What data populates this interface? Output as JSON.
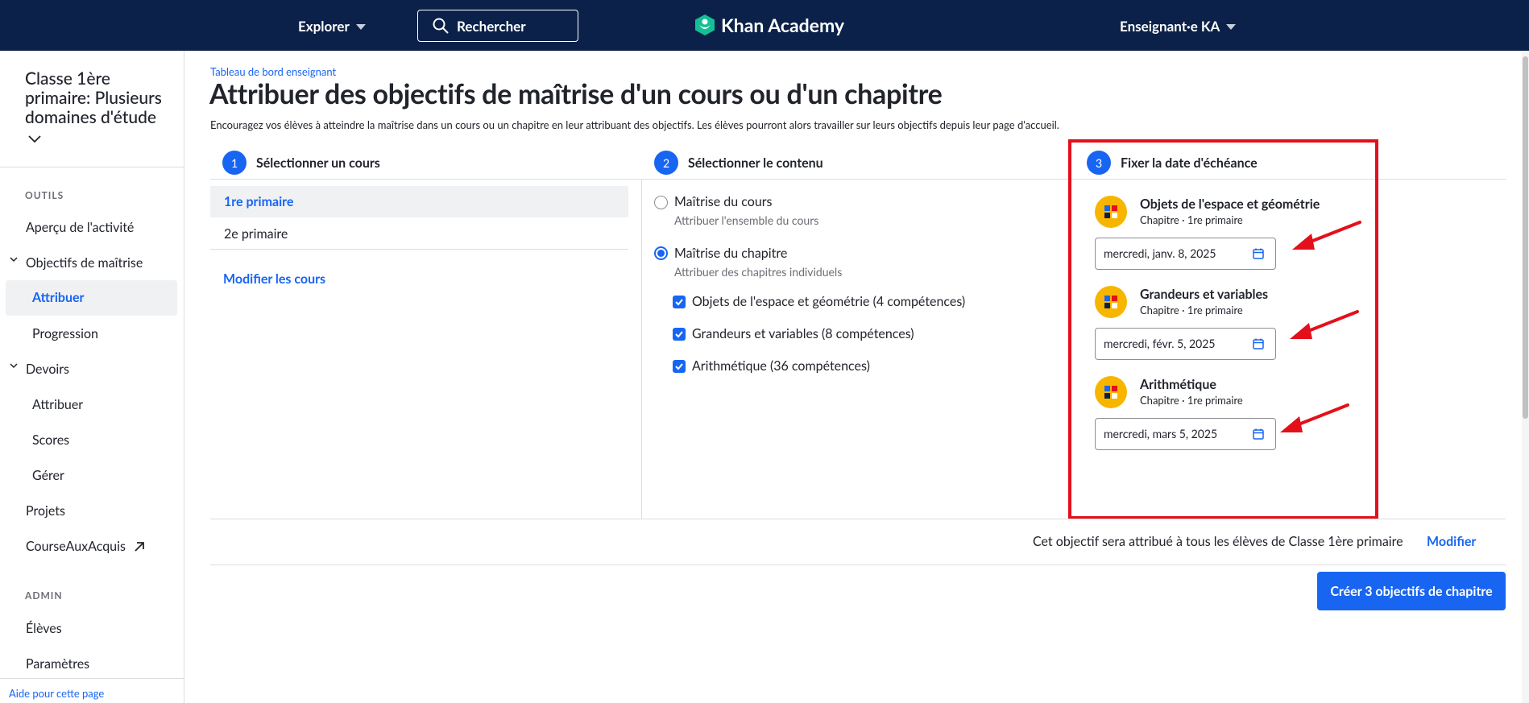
{
  "topnav": {
    "explore_label": "Explorer",
    "search_label": "Rechercher",
    "logo_text": "Khan Academy",
    "user_label": "Enseignant·e KA"
  },
  "sidebar": {
    "class_title": "Classe 1ère primaire: Plusieurs domaines d'étude",
    "section_tools": "OUTILS",
    "section_admin": "ADMIN",
    "items": {
      "activity": "Aperçu de l'activité",
      "mastery": "Objectifs de maîtrise",
      "mastery_assign": "Attribuer",
      "mastery_progress": "Progression",
      "homework": "Devoirs",
      "homework_assign": "Attribuer",
      "homework_scores": "Scores",
      "homework_manage": "Gérer",
      "projects": "Projets",
      "course_challenge": "CourseAuxAcquis",
      "students": "Élèves",
      "settings": "Paramètres"
    },
    "help_link": "Aide pour cette page"
  },
  "main": {
    "breadcrumb": "Tableau de bord enseignant",
    "title": "Attribuer des objectifs de maîtrise d'un cours ou d'un chapitre",
    "description": "Encouragez vos élèves à atteindre la maîtrise dans un cours ou un chapitre en leur attribuant des objectifs. Les élèves pourront alors travailler sur leurs objectifs depuis leur page d'accueil."
  },
  "steps": [
    {
      "num": "1",
      "label": "Sélectionner un cours"
    },
    {
      "num": "2",
      "label": "Sélectionner le contenu"
    },
    {
      "num": "3",
      "label": "Fixer la date d'échéance"
    }
  ],
  "courses": {
    "items": [
      "1re primaire",
      "2e primaire"
    ],
    "selected": "1re primaire",
    "modify_label": "Modifier les cours"
  },
  "content": {
    "course_mastery": {
      "label": "Maîtrise du cours",
      "sub": "Attribuer l'ensemble du cours",
      "checked": false
    },
    "chapter_mastery": {
      "label": "Maîtrise du chapitre",
      "sub": "Attribuer des chapitres individuels",
      "checked": true
    },
    "chapters": [
      {
        "label": "Objets de l'espace et géométrie (4 compétences)",
        "checked": true
      },
      {
        "label": "Grandeurs et variables (8 compétences)",
        "checked": true
      },
      {
        "label": "Arithmétique (36 compétences)",
        "checked": true
      }
    ]
  },
  "due_dates": [
    {
      "title": "Objets de l'espace et géométrie",
      "sub": "Chapitre · 1re primaire",
      "date": "mercredi, janv. 8, 2025"
    },
    {
      "title": "Grandeurs et variables",
      "sub": "Chapitre · 1re primaire",
      "date": "mercredi, févr. 5, 2025"
    },
    {
      "title": "Arithmétique",
      "sub": "Chapitre · 1re primaire",
      "date": "mercredi, mars 5, 2025"
    }
  ],
  "footer": {
    "assign_note": "Cet objectif sera attribué à tous les élèves de Classe 1ère primaire",
    "modify_label": "Modifier",
    "create_button": "Créer 3 objectifs de chapitre"
  },
  "colors": {
    "nav_bg": "#0b2149",
    "accent": "#1865f2",
    "annotation_red": "#e3101b",
    "chapter_icon": "#f7b500"
  }
}
